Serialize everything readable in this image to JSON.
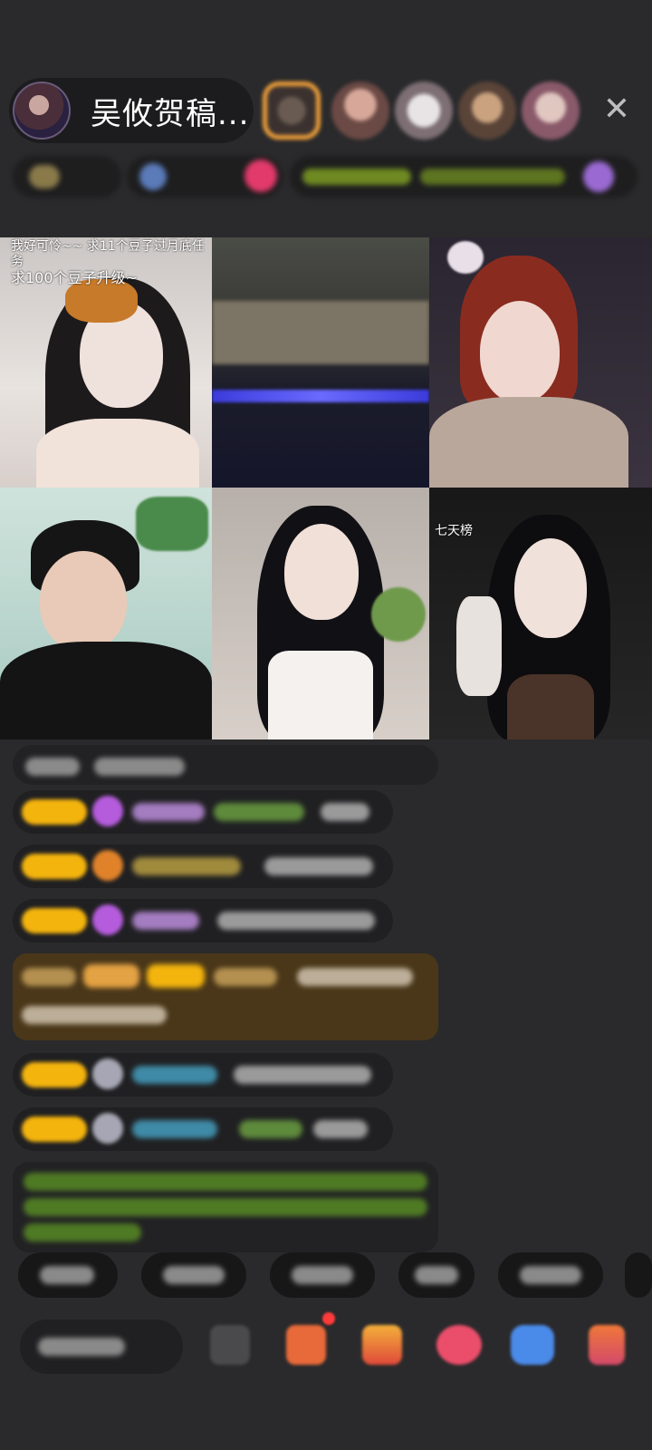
{
  "host": {
    "name": "吴攸贺稿..."
  },
  "viewers": [
    "viewer-1",
    "viewer-2",
    "viewer-3",
    "viewer-4",
    "viewer-5"
  ],
  "grid": {
    "tile1_caption_line1": "我好可怜~~ 求11个豆子过月底任务",
    "tile1_caption_line2": "求100个豆子升级~",
    "tile6_caption": "七天榜"
  },
  "icons": {
    "close": "close-icon"
  },
  "colors": {
    "background": "#2a2a2c",
    "badge": "#f4b40e",
    "accent_orange": "#f3a23a"
  }
}
